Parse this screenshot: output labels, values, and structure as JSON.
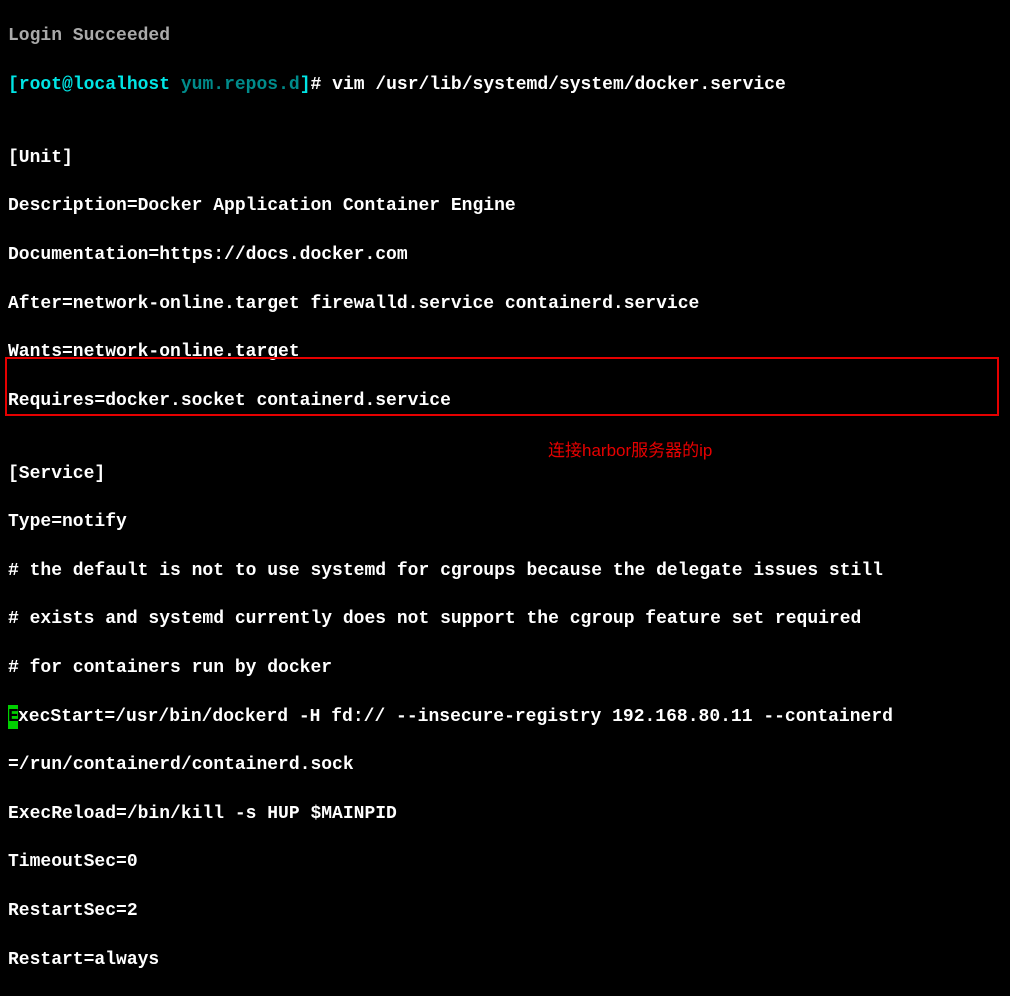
{
  "line0_partial": "Login Succeeded",
  "prompt": {
    "bracket_open": "[",
    "user_host": "root@localhost",
    "space": " ",
    "dir": "yum.repos.d",
    "bracket_close": "]",
    "hash": "# ",
    "command": "vim /usr/lib/systemd/system/docker.service"
  },
  "blank1": "",
  "line_unit": "[Unit]",
  "line_desc": "Description=Docker Application Container Engine",
  "line_doc": "Documentation=https://docs.docker.com",
  "line_after": "After=network-online.target firewalld.service containerd.service",
  "line_wants": "Wants=network-online.target",
  "line_requires": "Requires=docker.socket containerd.service",
  "blank2": "",
  "line_service": "[Service]",
  "line_type": "Type=notify",
  "line_comment1": "# the default is not to use systemd for cgroups because the delegate issues still",
  "line_comment2": "# exists and systemd currently does not support the cgroup feature set required",
  "line_comment3": "# for containers run by docker",
  "line_exec_first_char": "E",
  "line_exec_rest": "xecStart=/usr/bin/dockerd -H fd:// --insecure-registry 192.168.80.11 --containerd",
  "line_exec_cont": "=/run/containerd/containerd.sock",
  "line_reload": "ExecReload=/bin/kill -s HUP $MAINPID",
  "line_timeout": "TimeoutSec=0",
  "line_restartsec": "RestartSec=2",
  "line_restart": "Restart=always",
  "annotation_text": "连接harbor服务器的ip"
}
